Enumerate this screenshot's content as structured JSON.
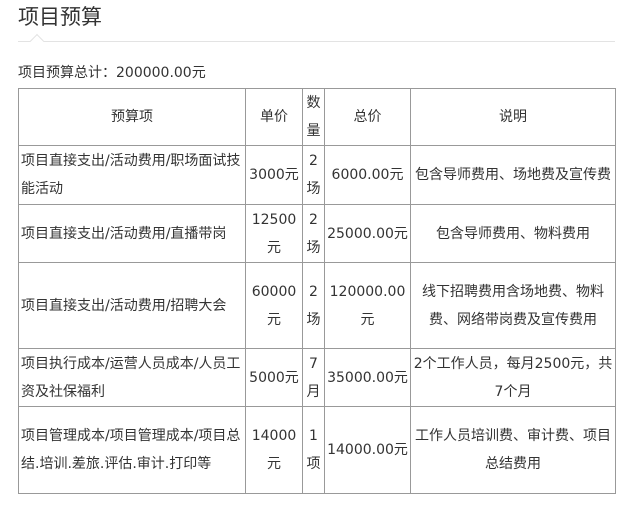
{
  "page": {
    "title": "项目预算",
    "total_text": "项目预算总计：200000.00元"
  },
  "table": {
    "headers": {
      "item": "预算项",
      "unit_price": "单价",
      "quantity": "数量",
      "total": "总价",
      "note": "说明"
    },
    "rows": [
      {
        "item": "项目直接支出/活动费用/职场面试技能活动",
        "unit_price": "3000元",
        "quantity": "2场",
        "total": "6000.00元",
        "note": "包含导师费用、场地费及宣传费"
      },
      {
        "item": "项目直接支出/活动费用/直播带岗",
        "unit_price": "12500元",
        "quantity": "2场",
        "total": "25000.00元",
        "note": "包含导师费用、物料费用"
      },
      {
        "item": "项目直接支出/活动费用/招聘大会",
        "unit_price": "60000元",
        "quantity": "2场",
        "total": "120000.00元",
        "note": "线下招聘费用含场地费、物料费、网络带岗费及宣传费用"
      },
      {
        "item": "项目执行成本/运营人员成本/人员工资及社保福利",
        "unit_price": "5000元",
        "quantity": "7月",
        "total": "35000.00元",
        "note": "2个工作人员，每月2500元，共7个月"
      },
      {
        "item": "项目管理成本/项目管理成本/项目总结.培训.差旅.评估.审计.打印等",
        "unit_price": "14000元",
        "quantity": "1项",
        "total": "14000.00元",
        "note": "工作人员培训费、审计费、项目总结费用"
      }
    ]
  }
}
